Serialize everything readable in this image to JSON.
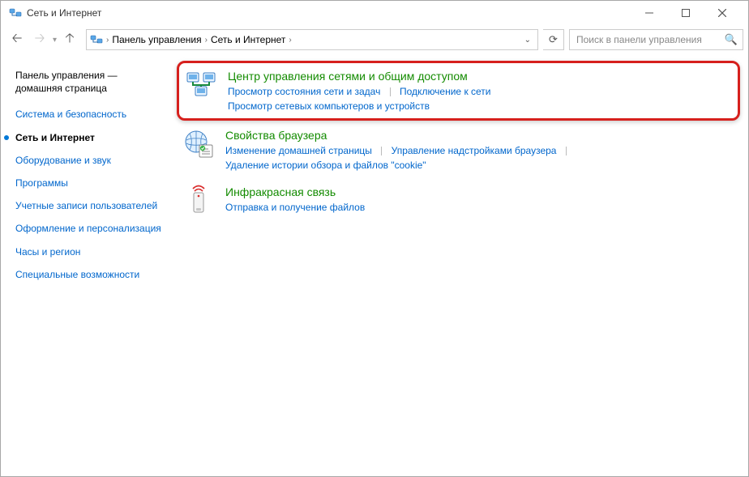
{
  "window": {
    "title": "Сеть и Интернет"
  },
  "breadcrumb": {
    "item1": "Панель управления",
    "item2": "Сеть и Интернет"
  },
  "search": {
    "placeholder": "Поиск в панели управления"
  },
  "sidebar": {
    "home_line1": "Панель управления —",
    "home_line2": "домашняя страница",
    "items": [
      "Система и безопасность",
      "Сеть и Интернет",
      "Оборудование и звук",
      "Программы",
      "Учетные записи пользователей",
      "Оформление и персонализация",
      "Часы и регион",
      "Специальные возможности"
    ]
  },
  "categories": {
    "network": {
      "title": "Центр управления сетями и общим доступом",
      "task1": "Просмотр состояния сети и задач",
      "task2": "Подключение к сети",
      "task3": "Просмотр сетевых компьютеров и устройств"
    },
    "browser": {
      "title": "Свойства браузера",
      "task1": "Изменение домашней страницы",
      "task2": "Управление надстройками браузера",
      "task3": "Удаление истории обзора и файлов \"cookie\""
    },
    "infrared": {
      "title": "Инфракрасная связь",
      "task1": "Отправка и получение файлов"
    }
  }
}
